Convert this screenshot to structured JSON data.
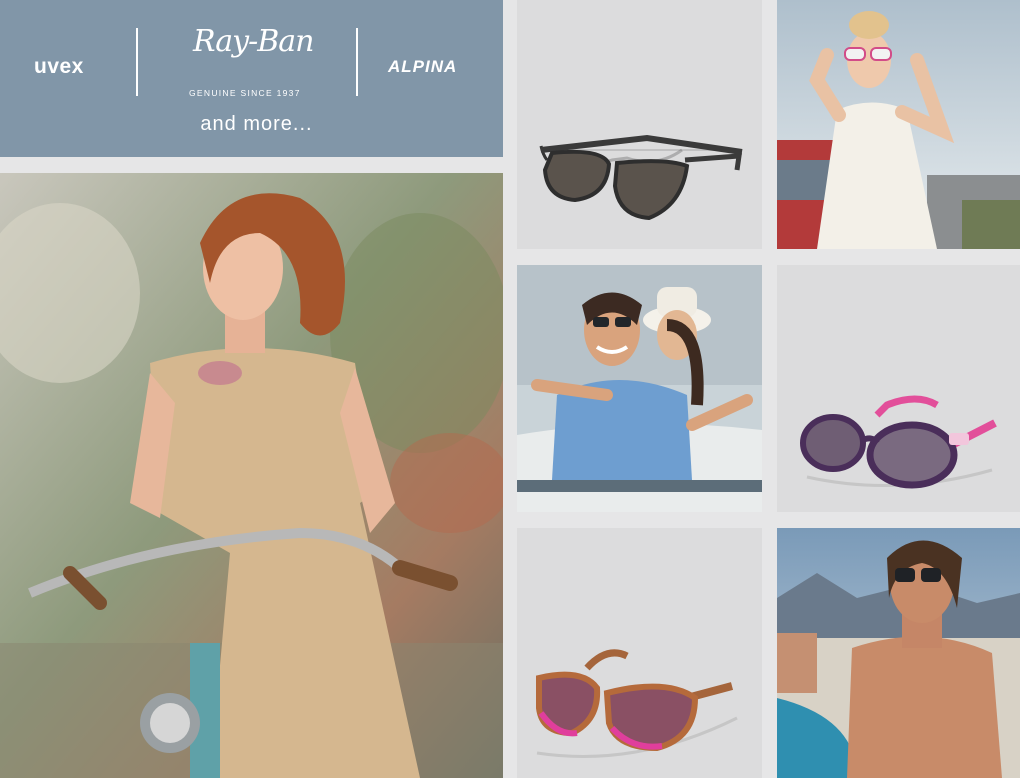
{
  "brands": {
    "uvex": "uvex",
    "rayban": "Ray-Ban",
    "rayban_tagline": "GENUINE SINCE 1937",
    "alpina": "ALPINA",
    "and_more": "and more..."
  },
  "colors": {
    "banner": "#8196a8",
    "tile_background": "#dcdcdd",
    "page_background": "#e6e6e7"
  },
  "tiles": [
    {
      "name": "woman-with-bicycle-photo",
      "kind": "photo"
    },
    {
      "name": "dark-grey-sunglasses-product",
      "kind": "product"
    },
    {
      "name": "woman-in-white-dress-photo",
      "kind": "photo"
    },
    {
      "name": "couple-on-boat-photo",
      "kind": "photo"
    },
    {
      "name": "purple-pink-sunglasses-product",
      "kind": "product"
    },
    {
      "name": "tortoise-pink-sunglasses-product",
      "kind": "product"
    },
    {
      "name": "man-at-beach-photo",
      "kind": "photo"
    }
  ]
}
